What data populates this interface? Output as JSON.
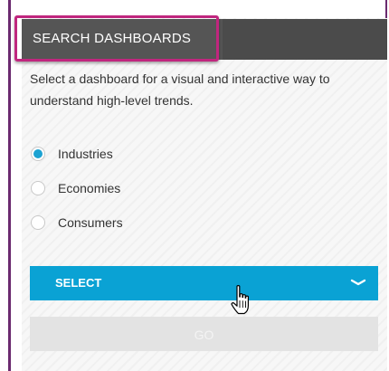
{
  "header": {
    "title": "SEARCH DASHBOARDS"
  },
  "description": "Select a dashboard for a visual and interactive way to understand high-level trends.",
  "options": [
    {
      "label": "Industries",
      "checked": true
    },
    {
      "label": "Economies",
      "checked": false
    },
    {
      "label": "Consumers",
      "checked": false
    }
  ],
  "select": {
    "label": "SELECT",
    "icon": "chevron-down-icon"
  },
  "go_button": {
    "label": "GO",
    "disabled": true
  },
  "colors": {
    "accent": "#0aa2d4",
    "highlight": "#c0267e",
    "header_bg": "#4b4b4b",
    "frame": "#6b2a6f",
    "disabled_bg": "#e3e3e3"
  },
  "cursor": "hand-pointer-icon"
}
